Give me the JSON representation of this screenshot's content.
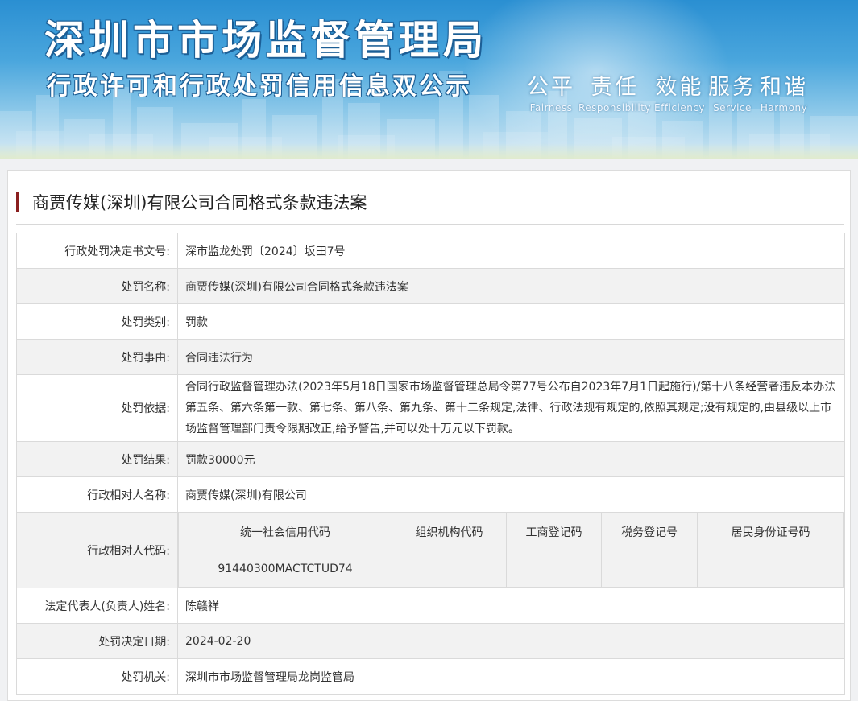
{
  "banner": {
    "title": "深圳市市场监督管理局",
    "subtitle": "行政许可和行政处罚信用信息双公示",
    "mottos": [
      {
        "cn": "公平",
        "en": "Fairness"
      },
      {
        "cn": "责任",
        "en": "Responsibility"
      },
      {
        "cn": "效能",
        "en": "Efficiency"
      },
      {
        "cn": "服务",
        "en": "Service"
      },
      {
        "cn": "和谐",
        "en": "Harmony"
      }
    ]
  },
  "case": {
    "title": "商贾传媒(深圳)有限公司合同格式条款违法案"
  },
  "fields": {
    "doc_no": {
      "label": "行政处罚决定书文号:",
      "value": "深市监龙处罚〔2024〕坂田7号"
    },
    "penalty_name": {
      "label": "处罚名称:",
      "value": "商贾传媒(深圳)有限公司合同格式条款违法案"
    },
    "penalty_type": {
      "label": "处罚类别:",
      "value": "罚款"
    },
    "penalty_cause": {
      "label": "处罚事由:",
      "value": "合同违法行为"
    },
    "penalty_basis": {
      "label": "处罚依据:",
      "value": "合同行政监督管理办法(2023年5月18日国家市场监督管理总局令第77号公布自2023年7月1日起施行)/第十八条经营者违反本办法第五条、第六条第一款、第七条、第八条、第九条、第十二条规定,法律、行政法规有规定的,依照其规定;没有规定的,由县级以上市场监督管理部门责令限期改正,给予警告,并可以处十万元以下罚款。"
    },
    "penalty_result": {
      "label": "处罚结果:",
      "value": "罚款30000元"
    },
    "party_name": {
      "label": "行政相对人名称:",
      "value": "商贾传媒(深圳)有限公司"
    },
    "party_code": {
      "label": "行政相对人代码:",
      "headers": [
        "统一社会信用代码",
        "组织机构代码",
        "工商登记码",
        "税务登记号",
        "居民身份证号码"
      ],
      "values": [
        "91440300MACTCTUD74",
        "",
        "",
        "",
        ""
      ]
    },
    "legal_rep": {
      "label": "法定代表人(负责人)姓名:",
      "value": "陈赣祥"
    },
    "decision_date": {
      "label": "处罚决定日期:",
      "value": "2024-02-20"
    },
    "authority": {
      "label": "处罚机关:",
      "value": "深圳市市场监督管理局龙岗监管局"
    }
  }
}
